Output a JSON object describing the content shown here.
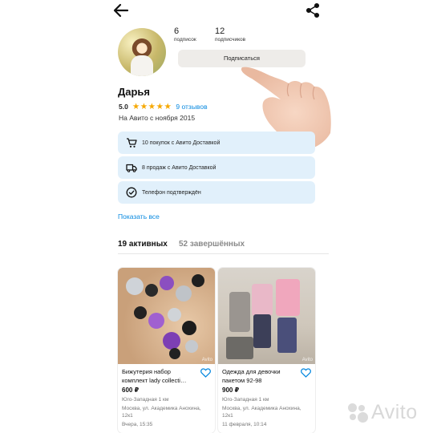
{
  "header": {
    "back_icon": "arrow-left-icon",
    "share_icon": "share-icon"
  },
  "profile": {
    "name": "Дарья",
    "rating": "5.0",
    "stars": "★★★★★",
    "reviews_label": "9 отзывов",
    "since": "На Авито с ноября 2015",
    "subscriptions_count": "6",
    "subscriptions_label": "подписок",
    "followers_count": "12",
    "followers_label": "подписчиков",
    "subscribe_label": "Подписаться"
  },
  "badges": [
    {
      "icon": "cart-icon",
      "text": "10 покупок с Авито Доставкой"
    },
    {
      "icon": "truck-icon",
      "text": "8 продаж с Авито Доставкой"
    },
    {
      "icon": "check-circle-icon",
      "text": "Телефон подтверждён"
    }
  ],
  "show_all_label": "Показать все",
  "tabs": [
    {
      "label": "19 активных",
      "active": true
    },
    {
      "label": "52 завершённых",
      "active": false
    }
  ],
  "listings": [
    {
      "title": "Бижутерия набор комплект lady collecti…",
      "price": "600 ₽",
      "metro": "Юго-Западная 1 км",
      "address": "Москва, ул. Академика Анохина, 12к1",
      "date": "Вчера, 15:35",
      "watermark": "Avito"
    },
    {
      "title": "Одежда для девочки пакетом 92-98",
      "price": "900 ₽",
      "metro": "Юго-Западная 1 км",
      "address": "Москва, ул. Академика Анохина, 12к1",
      "date": "11 февраля, 10:14",
      "watermark": "Avito"
    }
  ],
  "watermark_text": "Avito",
  "colors": {
    "link": "#0a8ae0",
    "star": "#f6a800",
    "badge_bg": "#e1f0fb",
    "button_bg": "#eeece9"
  }
}
